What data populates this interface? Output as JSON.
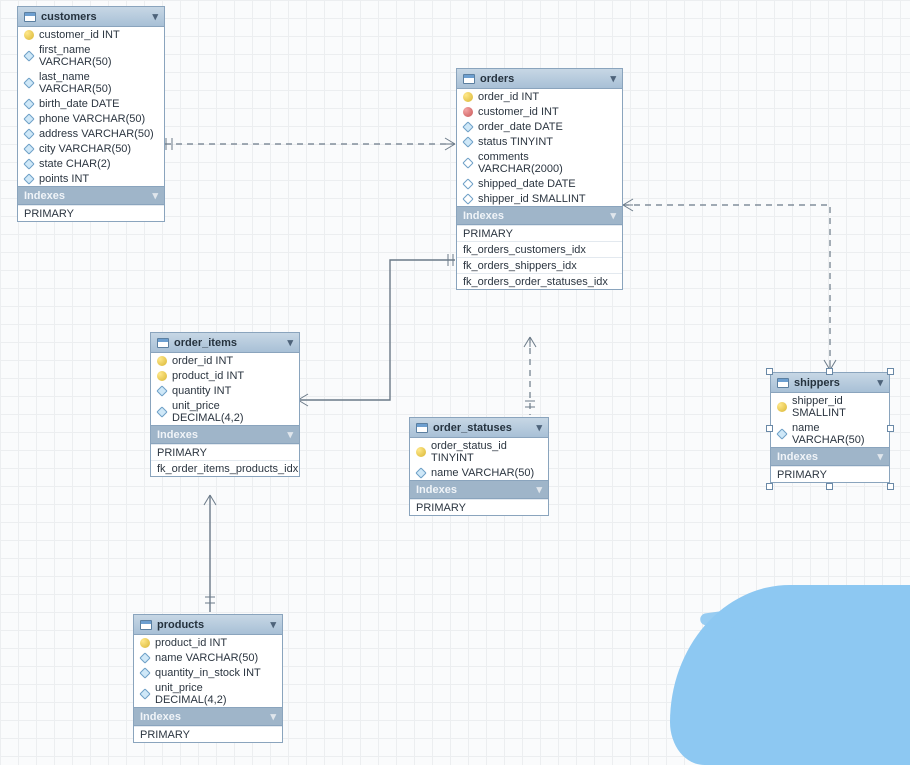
{
  "indexes_header": "Indexes",
  "tables": {
    "customers": {
      "name": "customers",
      "columns": [
        {
          "icon": "key",
          "text": "customer_id INT"
        },
        {
          "icon": "diamond",
          "text": "first_name VARCHAR(50)"
        },
        {
          "icon": "diamond",
          "text": "last_name VARCHAR(50)"
        },
        {
          "icon": "diamond",
          "text": "birth_date DATE"
        },
        {
          "icon": "diamond",
          "text": "phone VARCHAR(50)"
        },
        {
          "icon": "diamond",
          "text": "address VARCHAR(50)"
        },
        {
          "icon": "diamond",
          "text": "city VARCHAR(50)"
        },
        {
          "icon": "diamond",
          "text": "state CHAR(2)"
        },
        {
          "icon": "diamond",
          "text": "points INT"
        }
      ],
      "indexes": [
        "PRIMARY"
      ]
    },
    "orders": {
      "name": "orders",
      "columns": [
        {
          "icon": "key",
          "text": "order_id INT"
        },
        {
          "icon": "red",
          "text": "customer_id INT"
        },
        {
          "icon": "diamond",
          "text": "order_date DATE"
        },
        {
          "icon": "diamond",
          "text": "status TINYINT"
        },
        {
          "icon": "hollow",
          "text": "comments VARCHAR(2000)"
        },
        {
          "icon": "hollow",
          "text": "shipped_date DATE"
        },
        {
          "icon": "hollow",
          "text": "shipper_id SMALLINT"
        }
      ],
      "indexes": [
        "PRIMARY",
        "fk_orders_customers_idx",
        "fk_orders_shippers_idx",
        "fk_orders_order_statuses_idx"
      ]
    },
    "order_items": {
      "name": "order_items",
      "columns": [
        {
          "icon": "key",
          "text": "order_id INT"
        },
        {
          "icon": "key",
          "text": "product_id INT"
        },
        {
          "icon": "diamond",
          "text": "quantity INT"
        },
        {
          "icon": "diamond",
          "text": "unit_price DECIMAL(4,2)"
        }
      ],
      "indexes": [
        "PRIMARY",
        "fk_order_items_products_idx"
      ]
    },
    "order_statuses": {
      "name": "order_statuses",
      "columns": [
        {
          "icon": "key",
          "text": "order_status_id TINYINT"
        },
        {
          "icon": "diamond",
          "text": "name VARCHAR(50)"
        }
      ],
      "indexes": [
        "PRIMARY"
      ]
    },
    "shippers": {
      "name": "shippers",
      "columns": [
        {
          "icon": "key",
          "text": "shipper_id SMALLINT"
        },
        {
          "icon": "diamond",
          "text": "name VARCHAR(50)"
        }
      ],
      "indexes": [
        "PRIMARY"
      ]
    },
    "products": {
      "name": "products",
      "columns": [
        {
          "icon": "key",
          "text": "product_id INT"
        },
        {
          "icon": "diamond",
          "text": "name VARCHAR(50)"
        },
        {
          "icon": "diamond",
          "text": "quantity_in_stock INT"
        },
        {
          "icon": "diamond",
          "text": "unit_price DECIMAL(4,2)"
        }
      ],
      "indexes": [
        "PRIMARY"
      ]
    }
  }
}
